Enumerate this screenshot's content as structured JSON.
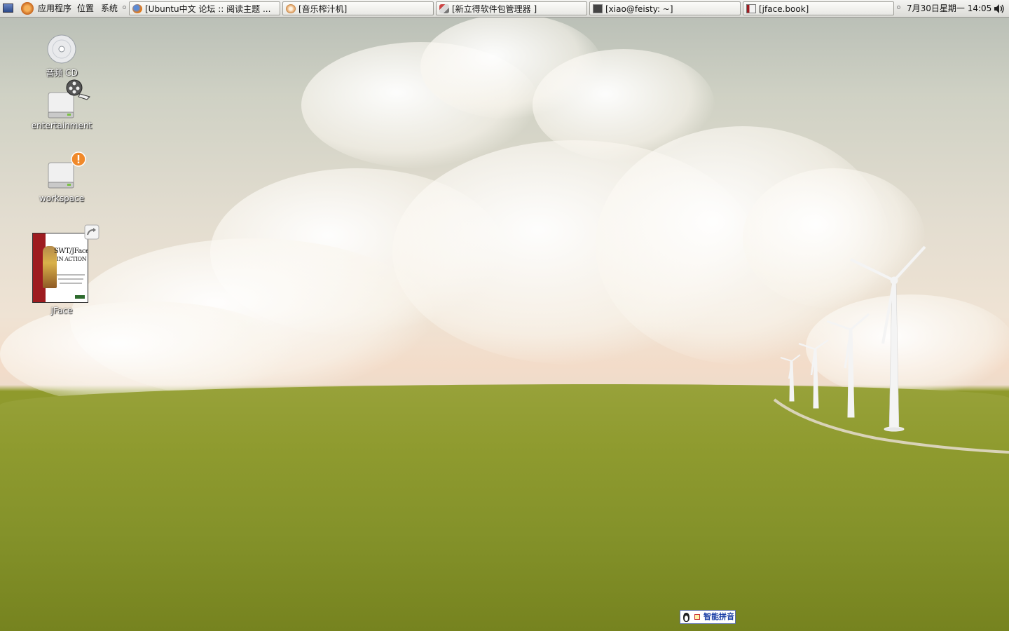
{
  "panel": {
    "menus": [
      {
        "label": "应用程序"
      },
      {
        "label": "位置"
      },
      {
        "label": "系统"
      }
    ],
    "tasks": [
      {
        "label": "[Ubuntu中文 论坛 :: 阅读主题 ...",
        "icon": "firefox-icon"
      },
      {
        "label": "[音乐榨汁机]",
        "icon": "music-player-icon"
      },
      {
        "label": "[新立得软件包管理器 ]",
        "icon": "package-manager-icon"
      },
      {
        "label": "[xiao@feisty: ~]",
        "icon": "terminal-icon"
      },
      {
        "label": "[jface.book]",
        "icon": "book-viewer-icon"
      }
    ],
    "clock": "7月30日星期一 14:05"
  },
  "desktop": {
    "icons": [
      {
        "label": "音频 CD",
        "icon": "audio-cd-icon"
      },
      {
        "label": "entertainment",
        "icon": "drive-icon"
      },
      {
        "label": "workspace",
        "icon": "drive-icon"
      },
      {
        "label": "JFace",
        "icon": "book-thumbnail-icon"
      }
    ],
    "book_cover": {
      "title_line1": "SWT/JFace",
      "title_line2": "IN ACTION"
    }
  },
  "ime": {
    "label": "智能拼音"
  }
}
